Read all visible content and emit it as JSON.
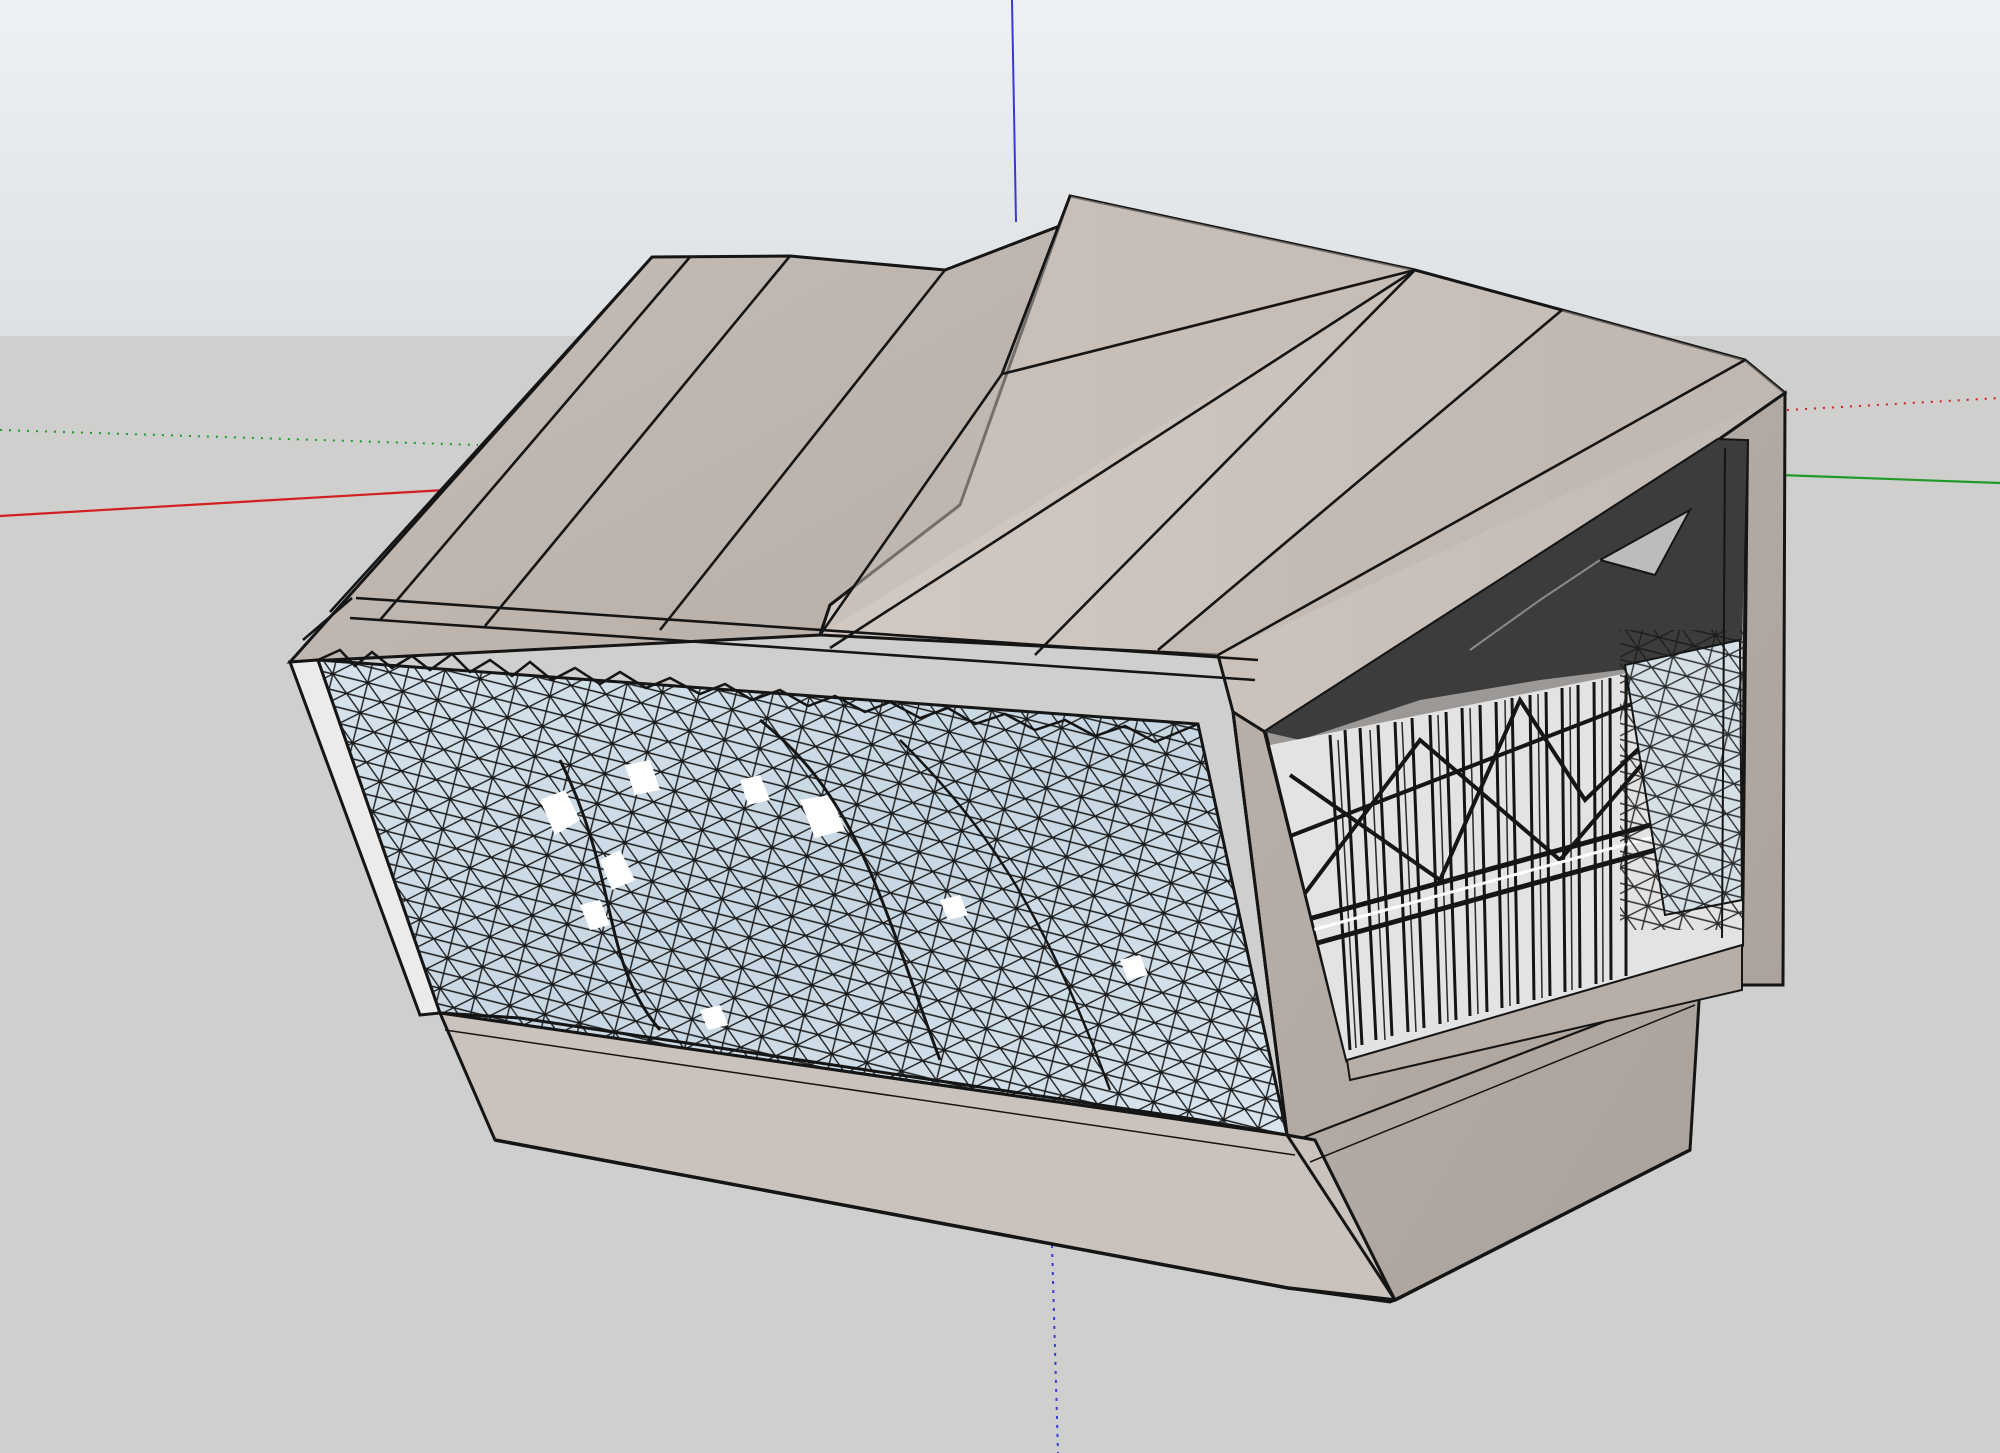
{
  "app": {
    "type": "3D modeling viewport"
  },
  "scene": {
    "colors": {
      "sky_top": "#e9edf0",
      "sky_bottom": "#dfe3e6",
      "ground": "#cfcfcd",
      "axis_red": "#d21f1f",
      "axis_green": "#1f9a2a",
      "axis_blue": "#3a3ad0",
      "wall_front": "#c9c1bb",
      "wall_side": "#b5aca6",
      "roof_light": "#cdc4be",
      "roof_mid": "#bcb3ad",
      "glass": "#cfdde8",
      "glass_highlight": "#ffffff",
      "edge": "#151515",
      "opening_dark": "#3c3c3c"
    },
    "objects": [
      {
        "name": "ground-plane"
      },
      {
        "name": "sky-gradient"
      },
      {
        "name": "red-axis"
      },
      {
        "name": "green-axis"
      },
      {
        "name": "blue-axis"
      },
      {
        "name": "building-model"
      },
      {
        "name": "triangulated-glass-facade"
      },
      {
        "name": "side-opening-with-vertical-fins"
      }
    ]
  }
}
